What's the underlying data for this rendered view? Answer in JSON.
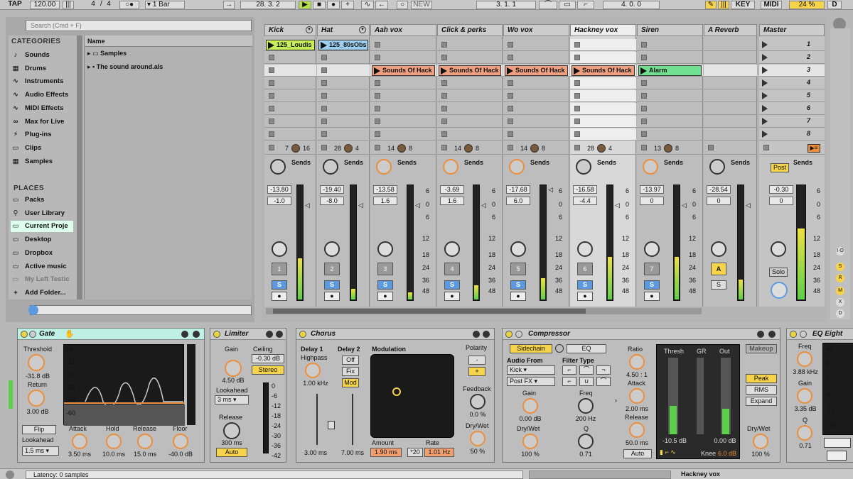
{
  "toolbar": {
    "tap": "TAP",
    "tempo": "120.00",
    "sig_num": "4",
    "sig_sep": "/",
    "sig_den": "4",
    "quant": "1 Bar",
    "position": "28.  3.  2",
    "new": "NEW",
    "loop_start": "3.  1.  1",
    "loop_len": "4.  0.  0",
    "key": "KEY",
    "midi": "MIDI",
    "cpu": "24 %",
    "d": "D"
  },
  "browser": {
    "search_placeholder": "Search (Cmd + F)",
    "categories_label": "CATEGORIES",
    "categories": [
      "Sounds",
      "Drums",
      "Instruments",
      "Audio Effects",
      "MIDI Effects",
      "Max for Live",
      "Plug-ins",
      "Clips",
      "Samples"
    ],
    "places_label": "PLACES",
    "places": [
      "Packs",
      "User Library",
      "Current Proje",
      "Desktop",
      "Dropbox",
      "Active music",
      "My Left Testic",
      "Add Folder..."
    ],
    "name_header": "Name",
    "files": [
      "Samples",
      "The sound around.als"
    ]
  },
  "tracks": [
    {
      "name": "Kick",
      "clips": [
        {
          "row": 0,
          "label": "125_Loudis",
          "color": "#c8ee58"
        }
      ],
      "n1": "7",
      "n2": "16",
      "vol": "-13.80",
      "pan": "-1.0",
      "num": "1"
    },
    {
      "name": "Hat",
      "clips": [
        {
          "row": 0,
          "label": "125_80sObs",
          "color": "#9ecff0"
        }
      ],
      "n1": "28",
      "n2": "4",
      "vol": "-19.40",
      "pan": "-8.0",
      "num": "2"
    },
    {
      "name": "Aah vox",
      "clips": [
        {
          "row": 2,
          "label": "Sounds Of Hack",
          "color": "#f0a080"
        }
      ],
      "n1": "14",
      "n2": "8",
      "vol": "-13.58",
      "pan": "1.6",
      "num": "3"
    },
    {
      "name": "Click & perks",
      "clips": [
        {
          "row": 2,
          "label": "Sounds Of Hack",
          "color": "#f0a080"
        }
      ],
      "n1": "14",
      "n2": "8",
      "vol": "-3.69",
      "pan": "1.6",
      "num": "4"
    },
    {
      "name": "Wo vox",
      "clips": [
        {
          "row": 2,
          "label": "Sounds Of Hack",
          "color": "#f0a080"
        }
      ],
      "n1": "14",
      "n2": "8",
      "vol": "-17.68",
      "pan": "6.0",
      "num": "5"
    },
    {
      "name": "Hackney vox",
      "clips": [
        {
          "row": 2,
          "label": "Sounds Of Hack",
          "color": "#f0a080"
        }
      ],
      "n1": "28",
      "n2": "4",
      "vol": "-16.58",
      "pan": "-4.4",
      "num": "6"
    },
    {
      "name": "Siren",
      "clips": [
        {
          "row": 2,
          "label": "Alarm",
          "color": "#70e090"
        }
      ],
      "n1": "13",
      "n2": "8",
      "vol": "-13.97",
      "pan": "0",
      "num": "7"
    },
    {
      "name": "A Reverb",
      "clips": [],
      "n1": "",
      "n2": "",
      "vol": "-28.54",
      "pan": "0",
      "num": "A"
    }
  ],
  "master": {
    "name": "Master",
    "scenes": [
      "1",
      "2",
      "3",
      "4",
      "5",
      "6",
      "7",
      "8"
    ],
    "vol": "-0.30",
    "pan": "0",
    "post": "Post",
    "solo": "Solo"
  },
  "sends_label": "Sends",
  "meter_ticks": [
    "6",
    "0",
    "6",
    "12",
    "18",
    "24",
    "36",
    "48"
  ],
  "devices": {
    "gate": {
      "title": "Gate",
      "threshold": "Threshold",
      "threshold_val": "-31.8 dB",
      "return": "Return",
      "return_val": "3.00 dB",
      "flip": "Flip",
      "lookahead": "Lookahead",
      "lookahead_val": "1.5 ms",
      "attack": "Attack",
      "attack_val": "3.50 ms",
      "hold": "Hold",
      "hold_val": "10.0 ms",
      "release": "Release",
      "release_val": "15.0 ms",
      "floor": "Floor",
      "floor_val": "-40.0 dB",
      "scale": [
        "+6",
        "-12",
        "-24",
        "-36",
        "-48",
        "-60"
      ]
    },
    "limiter": {
      "title": "Limiter",
      "gain": "Gain",
      "gain_val": "4.50 dB",
      "ceiling": "Ceiling",
      "ceiling_val": "-0.30 dB",
      "stereo": "Stereo",
      "lookahead": "Lookahead",
      "lookahead_val": "3 ms",
      "release": "Release",
      "release_val": "300 ms",
      "auto": "Auto",
      "scale": [
        "0",
        "-6",
        "-12",
        "-18",
        "-24",
        "-30",
        "-36",
        "-42"
      ]
    },
    "chorus": {
      "title": "Chorus",
      "delay1": "Delay 1",
      "highpass": "Highpass",
      "highpass_val": "1.00 kHz",
      "delay2": "Delay 2",
      "off": "Off",
      "fix": "Fix",
      "mod": "Mod",
      "d1_val": "3.00 ms",
      "d2_val": "7.00 ms",
      "modulation": "Modulation",
      "amount": "Amount",
      "amount_val": "1.90 ms",
      "x20": "*20",
      "rate": "Rate",
      "rate_val": "1.01 Hz",
      "polarity": "Polarity",
      "pol_minus": "-",
      "pol_plus": "+",
      "feedback": "Feedback",
      "feedback_val": "0.0 %",
      "drywet": "Dry/Wet",
      "drywet_val": "50 %"
    },
    "compressor": {
      "title": "Compressor",
      "sidechain": "Sidechain",
      "eq": "EQ",
      "audio_from": "Audio From",
      "src": "Kick",
      "post_fx": "Post FX",
      "gain": "Gain",
      "gain_val": "0.00 dB",
      "drywet": "Dry/Wet",
      "drywet_val": "100 %",
      "filter_type": "Filter Type",
      "freq": "Freq",
      "freq_val": "200 Hz",
      "q": "Q",
      "q_val": "0.71",
      "ratio": "Ratio",
      "ratio_val": "4.50 : 1",
      "attack": "Attack",
      "attack_val": "2.00 ms",
      "release": "Release",
      "release_val": "50.0 ms",
      "auto": "Auto",
      "thresh": "Thresh",
      "gr": "GR",
      "out": "Out",
      "thresh_val": "-10.5 dB",
      "out_val": "0.00 dB",
      "knee": "Knee",
      "knee_val": "6.0 dB",
      "makeup": "Makeup",
      "peak": "Peak",
      "rms": "RMS",
      "expand": "Expand",
      "drywet2": "Dry/Wet",
      "drywet2_val": "100 %"
    },
    "eq": {
      "title": "EQ Eight",
      "freq": "Freq",
      "freq_val": "3.88 kHz",
      "gain": "Gain",
      "gain_val": "3.35 dB",
      "q": "Q",
      "q_val": "0.71",
      "scale": [
        "12",
        "6",
        "0",
        "-6",
        "-12",
        "-70"
      ]
    }
  },
  "status": {
    "latency": "Latency: 0 samples",
    "track": "Hackney vox"
  }
}
